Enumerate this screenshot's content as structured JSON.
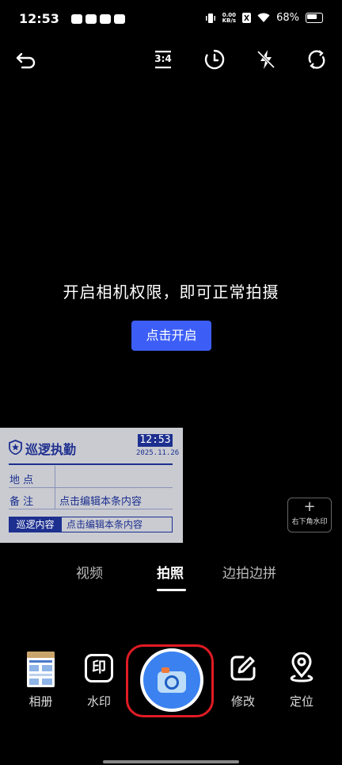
{
  "status_bar": {
    "time": "12:53",
    "net_speed_value": "0.00",
    "net_speed_unit": "KB/s",
    "battery": "68%"
  },
  "toolbar": {
    "icons": [
      "back-arrow-icon",
      "aspect-ratio-icon",
      "timer-icon",
      "flash-off-icon",
      "switch-camera-icon"
    ],
    "aspect_label": "3:4"
  },
  "permission": {
    "message": "开启相机权限，即可正常拍摄",
    "button_label": "点击开启"
  },
  "watermark": {
    "title": "巡逻执勤",
    "time": "12:53",
    "date": "2025.11.26",
    "location_label": "地  点",
    "note_label": "备  注",
    "note_value": "点击编辑本条内容",
    "patrol_label": "巡逻内容",
    "patrol_value": "点击编辑本条内容",
    "brand_color": "#1d2f8f"
  },
  "corner_watermark_button": {
    "plus": "+",
    "label": "右下角水印"
  },
  "modes": [
    {
      "label": "视频"
    },
    {
      "label": "拍照"
    },
    {
      "label": "边拍边拼"
    }
  ],
  "active_mode": "拍照",
  "controls": {
    "album_label": "相册",
    "watermark_label": "水印",
    "watermark_icon_char": "印",
    "edit_label": "修改",
    "locate_label": "定位"
  },
  "colors": {
    "accent": "#3d5ef6",
    "shutter": "#3b82f0",
    "highlight_ring": "#e01b24"
  }
}
